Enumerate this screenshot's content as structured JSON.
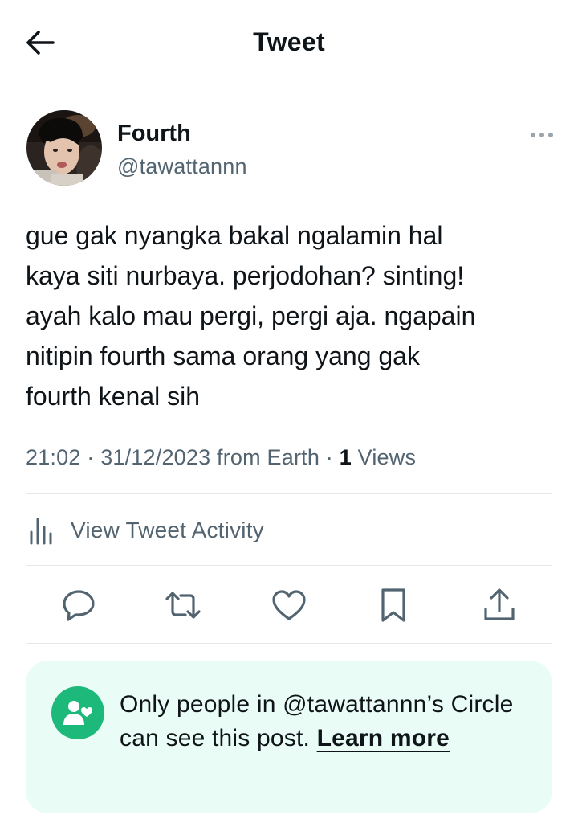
{
  "header": {
    "title": "Tweet",
    "back_icon": "arrow-left-icon"
  },
  "author": {
    "display_name": "Fourth",
    "handle": "@tawattannn"
  },
  "tweet": {
    "text": "gue gak nyangka bakal ngalamin hal\nkaya siti nurbaya. perjodohan? sinting!\nayah kalo mau pergi, pergi aja. ngapain\nnitipin fourth sama orang yang gak\nfourth kenal sih",
    "time": "21:02",
    "date": "31/12/2023",
    "location": "from Earth",
    "views_count": "1",
    "views_label": "Views"
  },
  "activity": {
    "label": "View Tweet Activity",
    "icon": "bar-chart-icon"
  },
  "actions": [
    "reply-icon",
    "retweet-icon",
    "like-icon",
    "bookmark-icon",
    "share-icon"
  ],
  "circle_notice": {
    "text": "Only people in @tawattannn’s Circle can see this post.",
    "link": "Learn more"
  },
  "colors": {
    "text_primary": "#0f1419",
    "text_secondary": "#536471",
    "divider": "#e4e8eb",
    "circle_bg": "#e9fcf5",
    "circle_green": "#1db97a"
  }
}
